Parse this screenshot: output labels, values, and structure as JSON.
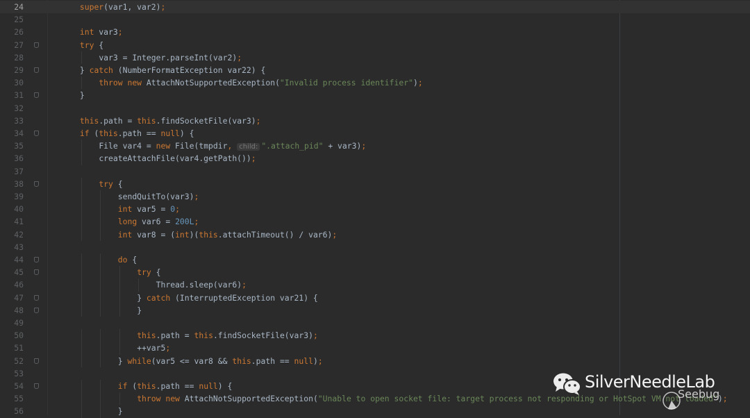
{
  "editor": {
    "current_line": 24,
    "colors": {
      "background": "#2b2b2b",
      "current_line": "#323232",
      "keyword": "#cc7832",
      "string": "#6a8759",
      "number": "#6897bb",
      "text": "#a9b7c6",
      "line_number": "#5f6265"
    },
    "fold_lines": [
      27,
      29,
      31,
      34,
      38,
      44,
      45,
      47,
      48,
      52,
      54
    ],
    "lines": [
      {
        "n": "24",
        "indent": 8,
        "tokens": [
          [
            "kw",
            "super"
          ],
          [
            "pl",
            "(var1, var2)"
          ],
          [
            "kw",
            ";"
          ]
        ]
      },
      {
        "n": "25",
        "indent": 0,
        "tokens": []
      },
      {
        "n": "26",
        "indent": 8,
        "tokens": [
          [
            "kw",
            "int"
          ],
          [
            "pl",
            " var3"
          ],
          [
            "kw",
            ";"
          ]
        ]
      },
      {
        "n": "27",
        "indent": 8,
        "tokens": [
          [
            "kw",
            "try"
          ],
          [
            "pl",
            " {"
          ]
        ]
      },
      {
        "n": "28",
        "indent": 12,
        "tokens": [
          [
            "pl",
            "var3 = Integer.parseInt(var2)"
          ],
          [
            "kw",
            ";"
          ]
        ]
      },
      {
        "n": "29",
        "indent": 8,
        "tokens": [
          [
            "pl",
            "} "
          ],
          [
            "kw",
            "catch"
          ],
          [
            "pl",
            " (NumberFormatException var22) {"
          ]
        ]
      },
      {
        "n": "30",
        "indent": 12,
        "tokens": [
          [
            "kw",
            "throw new"
          ],
          [
            "pl",
            " AttachNotSupportedException("
          ],
          [
            "str",
            "\"Invalid process identifier\""
          ],
          [
            "pl",
            ")"
          ],
          [
            "kw",
            ";"
          ]
        ]
      },
      {
        "n": "31",
        "indent": 8,
        "tokens": [
          [
            "pl",
            "}"
          ]
        ]
      },
      {
        "n": "32",
        "indent": 0,
        "tokens": []
      },
      {
        "n": "33",
        "indent": 8,
        "tokens": [
          [
            "kw",
            "this"
          ],
          [
            "pl",
            ".path = "
          ],
          [
            "kw",
            "this"
          ],
          [
            "pl",
            ".findSocketFile(var3)"
          ],
          [
            "kw",
            ";"
          ]
        ]
      },
      {
        "n": "34",
        "indent": 8,
        "tokens": [
          [
            "kw",
            "if"
          ],
          [
            "pl",
            " ("
          ],
          [
            "kw",
            "this"
          ],
          [
            "pl",
            ".path == "
          ],
          [
            "kw",
            "null"
          ],
          [
            "pl",
            ") {"
          ]
        ]
      },
      {
        "n": "35",
        "indent": 12,
        "tokens": [
          [
            "pl",
            "File var4 = "
          ],
          [
            "kw",
            "new"
          ],
          [
            "pl",
            " File(tmpdir"
          ],
          [
            "kw",
            ","
          ],
          [
            "pl",
            " "
          ],
          [
            "hint",
            "child:"
          ],
          [
            "str",
            "\".attach_pid\""
          ],
          [
            "pl",
            " + var3)"
          ],
          [
            "kw",
            ";"
          ]
        ]
      },
      {
        "n": "36",
        "indent": 12,
        "tokens": [
          [
            "pl",
            "createAttachFile(var4.getPath())"
          ],
          [
            "kw",
            ";"
          ]
        ]
      },
      {
        "n": "37",
        "indent": 0,
        "tokens": []
      },
      {
        "n": "38",
        "indent": 12,
        "tokens": [
          [
            "kw",
            "try"
          ],
          [
            "pl",
            " {"
          ]
        ]
      },
      {
        "n": "39",
        "indent": 16,
        "tokens": [
          [
            "pl",
            "sendQuitTo(var3)"
          ],
          [
            "kw",
            ";"
          ]
        ]
      },
      {
        "n": "40",
        "indent": 16,
        "tokens": [
          [
            "kw",
            "int"
          ],
          [
            "pl",
            " var5 = "
          ],
          [
            "num",
            "0"
          ],
          [
            "kw",
            ";"
          ]
        ]
      },
      {
        "n": "41",
        "indent": 16,
        "tokens": [
          [
            "kw",
            "long"
          ],
          [
            "pl",
            " var6 = "
          ],
          [
            "num",
            "200L"
          ],
          [
            "kw",
            ";"
          ]
        ]
      },
      {
        "n": "42",
        "indent": 16,
        "tokens": [
          [
            "kw",
            "int"
          ],
          [
            "pl",
            " var8 = ("
          ],
          [
            "kw",
            "int"
          ],
          [
            "pl",
            ")("
          ],
          [
            "kw",
            "this"
          ],
          [
            "pl",
            ".attachTimeout() / var6)"
          ],
          [
            "kw",
            ";"
          ]
        ]
      },
      {
        "n": "43",
        "indent": 0,
        "tokens": []
      },
      {
        "n": "44",
        "indent": 16,
        "tokens": [
          [
            "kw",
            "do"
          ],
          [
            "pl",
            " {"
          ]
        ]
      },
      {
        "n": "45",
        "indent": 20,
        "tokens": [
          [
            "kw",
            "try"
          ],
          [
            "pl",
            " {"
          ]
        ]
      },
      {
        "n": "46",
        "indent": 24,
        "tokens": [
          [
            "pl",
            "Thread.sleep(var6)"
          ],
          [
            "kw",
            ";"
          ]
        ]
      },
      {
        "n": "47",
        "indent": 20,
        "tokens": [
          [
            "pl",
            "} "
          ],
          [
            "kw",
            "catch"
          ],
          [
            "pl",
            " (InterruptedException var21) {"
          ]
        ]
      },
      {
        "n": "48",
        "indent": 20,
        "tokens": [
          [
            "pl",
            "}"
          ]
        ]
      },
      {
        "n": "49",
        "indent": 0,
        "tokens": []
      },
      {
        "n": "50",
        "indent": 20,
        "tokens": [
          [
            "kw",
            "this"
          ],
          [
            "pl",
            ".path = "
          ],
          [
            "kw",
            "this"
          ],
          [
            "pl",
            ".findSocketFile(var3)"
          ],
          [
            "kw",
            ";"
          ]
        ]
      },
      {
        "n": "51",
        "indent": 20,
        "tokens": [
          [
            "pl",
            "++var5"
          ],
          [
            "kw",
            ";"
          ]
        ]
      },
      {
        "n": "52",
        "indent": 16,
        "tokens": [
          [
            "pl",
            "} "
          ],
          [
            "kw",
            "while"
          ],
          [
            "pl",
            "(var5 <= var8 && "
          ],
          [
            "kw",
            "this"
          ],
          [
            "pl",
            ".path == "
          ],
          [
            "kw",
            "null"
          ],
          [
            "pl",
            ")"
          ],
          [
            "kw",
            ";"
          ]
        ]
      },
      {
        "n": "53",
        "indent": 0,
        "tokens": []
      },
      {
        "n": "54",
        "indent": 16,
        "tokens": [
          [
            "kw",
            "if"
          ],
          [
            "pl",
            " ("
          ],
          [
            "kw",
            "this"
          ],
          [
            "pl",
            ".path == "
          ],
          [
            "kw",
            "null"
          ],
          [
            "pl",
            ") {"
          ]
        ]
      },
      {
        "n": "55",
        "indent": 20,
        "tokens": [
          [
            "kw",
            "throw new"
          ],
          [
            "pl",
            " AttachNotSupportedException("
          ],
          [
            "str",
            "\"Unable to open socket file: target process not responding or HotSpot VM not loaded\""
          ],
          [
            "pl",
            ")"
          ],
          [
            "kw",
            ";"
          ]
        ]
      },
      {
        "n": "56",
        "indent": 16,
        "tokens": [
          [
            "pl",
            "}"
          ]
        ]
      }
    ]
  },
  "watermark": {
    "title": "SilverNeedleLab",
    "subtitle": "Seebug",
    "icon": "wechat-icon"
  }
}
